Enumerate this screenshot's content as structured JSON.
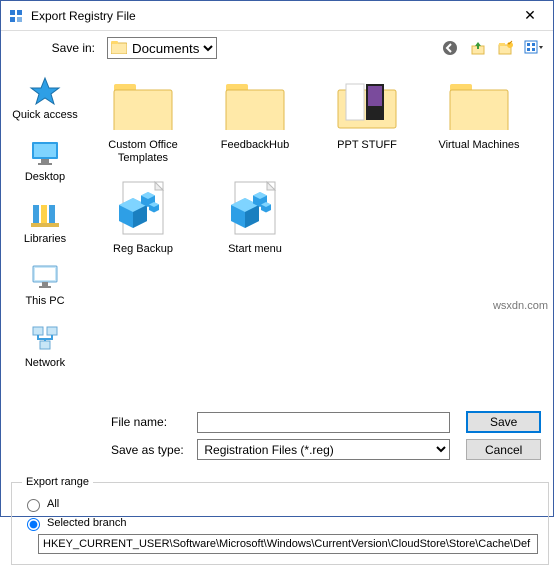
{
  "window": {
    "title": "Export Registry File",
    "close_glyph": "✕"
  },
  "toolbar": {
    "save_in_label": "Save in:",
    "location": "Documents"
  },
  "sidebar": [
    {
      "id": "quick-access",
      "label": "Quick access"
    },
    {
      "id": "desktop",
      "label": "Desktop"
    },
    {
      "id": "libraries",
      "label": "Libraries"
    },
    {
      "id": "this-pc",
      "label": "This PC"
    },
    {
      "id": "network",
      "label": "Network"
    }
  ],
  "files": [
    {
      "id": "custom-office-templates",
      "label": "Custom Office Templates",
      "kind": "folder"
    },
    {
      "id": "feedbackhub",
      "label": "FeedbackHub",
      "kind": "folder"
    },
    {
      "id": "ppt-stuff",
      "label": "PPT STUFF",
      "kind": "folder-mixed"
    },
    {
      "id": "virtual-machines",
      "label": "Virtual Machines",
      "kind": "folder"
    },
    {
      "id": "reg-backup",
      "label": "Reg Backup",
      "kind": "reg"
    },
    {
      "id": "start-menu",
      "label": "Start menu",
      "kind": "reg"
    }
  ],
  "fields": {
    "file_name_label": "File name:",
    "file_name_value": "",
    "save_as_type_label": "Save as type:",
    "save_as_type_value": "Registration Files (*.reg)"
  },
  "buttons": {
    "save": "Save",
    "cancel": "Cancel"
  },
  "export_range": {
    "legend": "Export range",
    "all_label": "All",
    "selected_branch_label": "Selected branch",
    "selected": "selected_branch",
    "branch_value": "HKEY_CURRENT_USER\\Software\\Microsoft\\Windows\\CurrentVersion\\CloudStore\\Store\\Cache\\Def"
  },
  "watermark": "wsxdn.com"
}
